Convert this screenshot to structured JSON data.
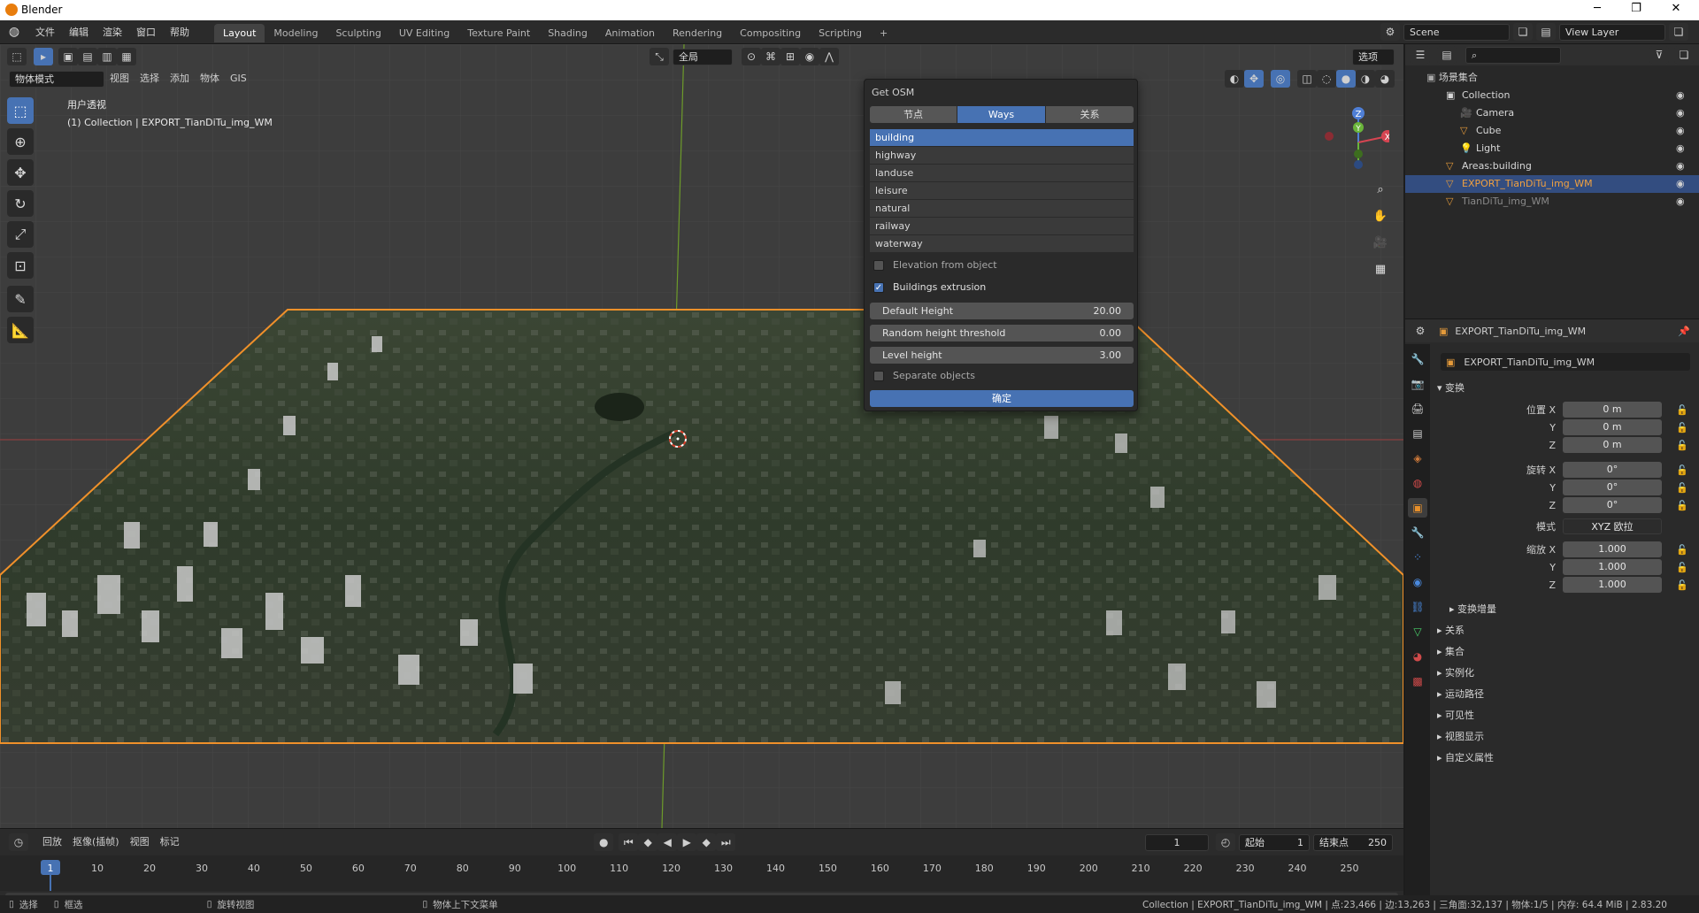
{
  "window": {
    "title": "Blender",
    "minimize": "─",
    "maximize": "❐",
    "close": "✕"
  },
  "topbar": {
    "menus": [
      "文件",
      "编辑",
      "渲染",
      "窗口",
      "帮助"
    ],
    "workspaces": [
      "Layout",
      "Modeling",
      "Sculpting",
      "UV Editing",
      "Texture Paint",
      "Shading",
      "Animation",
      "Rendering",
      "Compositing",
      "Scripting"
    ],
    "add_tab": "+",
    "scene": "Scene",
    "view_layer": "View Layer"
  },
  "viewport": {
    "mode": "物体模式",
    "menus": [
      "视图",
      "选择",
      "添加",
      "物体",
      "GIS"
    ],
    "transform_orientation": "全局",
    "options": "选项",
    "info_line1": "用户透视",
    "info_line2": "(1) Collection | EXPORT_TianDiTu_img_WM",
    "gizmo_labels": {
      "z": "Z",
      "y": "Y",
      "x": "X"
    }
  },
  "osm_panel": {
    "title": "Get OSM",
    "tabs": [
      "节点",
      "Ways",
      "关系"
    ],
    "active_tab": 1,
    "items": [
      "building",
      "highway",
      "landuse",
      "leisure",
      "natural",
      "railway",
      "waterway"
    ],
    "active_item": 0,
    "elevation_label": "Elevation from object",
    "elevation_checked": false,
    "extrusion_label": "Buildings extrusion",
    "extrusion_checked": true,
    "default_height_label": "Default Height",
    "default_height_value": "20.00",
    "random_threshold_label": "Random height threshold",
    "random_threshold_value": "0.00",
    "level_height_label": "Level height",
    "level_height_value": "3.00",
    "separate_label": "Separate objects",
    "separate_checked": false,
    "ok_label": "确定"
  },
  "timeline": {
    "menus": [
      "回放",
      "抠像(插帧)",
      "视图",
      "标记"
    ],
    "current_frame": "1",
    "start_label": "起始",
    "start_value": "1",
    "end_label": "结束点",
    "end_value": "250",
    "ticks": [
      "1",
      "10",
      "20",
      "30",
      "40",
      "50",
      "60",
      "70",
      "80",
      "90",
      "100",
      "110",
      "120",
      "130",
      "140",
      "150",
      "160",
      "170",
      "180",
      "190",
      "200",
      "210",
      "220",
      "230",
      "240",
      "250"
    ]
  },
  "statusbar": {
    "select": "选择",
    "box_select": "框选",
    "rotate": "旋转视图",
    "context_menu": "物体上下文菜单",
    "info": "Collection | EXPORT_TianDiTu_img_WM | 点:23,466 | 边:13,263 | 三角面:32,137 | 物体:1/5 | 内存: 64.4 MiB | 2.83.20"
  },
  "outliner": {
    "root": "场景集合",
    "rows": [
      {
        "name": "Collection",
        "icon": "collection-icon",
        "depth": 1,
        "selected": false,
        "dim": false
      },
      {
        "name": "Camera",
        "icon": "camera-icon",
        "depth": 2,
        "selected": false,
        "dim": false
      },
      {
        "name": "Cube",
        "icon": "mesh-icon",
        "depth": 2,
        "selected": false,
        "dim": false
      },
      {
        "name": "Light",
        "icon": "light-icon",
        "depth": 2,
        "selected": false,
        "dim": false
      },
      {
        "name": "Areas:building",
        "icon": "mesh-icon",
        "depth": 1,
        "selected": false,
        "dim": false
      },
      {
        "name": "EXPORT_TianDiTu_img_WM",
        "icon": "mesh-icon",
        "depth": 1,
        "selected": true,
        "dim": false
      },
      {
        "name": "TianDiTu_img_WM",
        "icon": "mesh-icon",
        "depth": 1,
        "selected": false,
        "dim": true
      }
    ]
  },
  "properties": {
    "object_name": "EXPORT_TianDiTu_img_WM",
    "data_name": "EXPORT_TianDiTu_img_WM",
    "transform_header": "变换",
    "location_label": "位置 X",
    "rotation_label": "旋转 X",
    "scale_label": "缩放 X",
    "axis_y": "Y",
    "axis_z": "Z",
    "location": [
      "0 m",
      "0 m",
      "0 m"
    ],
    "rotation": [
      "0°",
      "0°",
      "0°"
    ],
    "mode_label": "模式",
    "mode_value": "XYZ 欧拉",
    "scale": [
      "1.000",
      "1.000",
      "1.000"
    ],
    "delta_transform": "变换增量",
    "sections": [
      "关系",
      "集合",
      "实例化",
      "运动路径",
      "可见性",
      "视图显示",
      "自定义属性"
    ]
  },
  "colors": {
    "accent": "#4772b3",
    "selection_orange": "#f0902a",
    "grid_bg": "#3d3d3d"
  }
}
